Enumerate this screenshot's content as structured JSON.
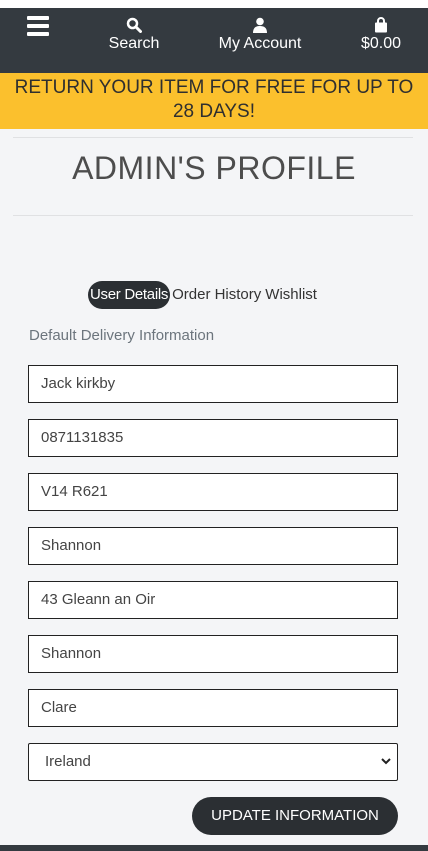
{
  "nav": {
    "search_label": "Search",
    "account_label": "My Account",
    "cart_total": "$0.00"
  },
  "banner": {
    "line1": "RETURN YOUR ITEM FOR FREE FOR UP TO",
    "line2": "28 DAYS!"
  },
  "profile": {
    "title": "ADMIN'S PROFILE",
    "tabs": [
      "User Details",
      "Order History",
      "Wishlist"
    ],
    "section_label": "Default Delivery Information"
  },
  "form": {
    "full_name": "Jack kirkby",
    "phone": "0871131835",
    "postcode": "V14 R621",
    "town": "Shannon",
    "street": "43 Gleann an Oir",
    "town2": "Shannon",
    "county": "Clare",
    "country": "Ireland",
    "submit_label": "UPDATE INFORMATION"
  },
  "colors": {
    "nav_bg": "#343a40",
    "banner_bg": "#fbc02d",
    "button_bg": "#2b2f33"
  }
}
